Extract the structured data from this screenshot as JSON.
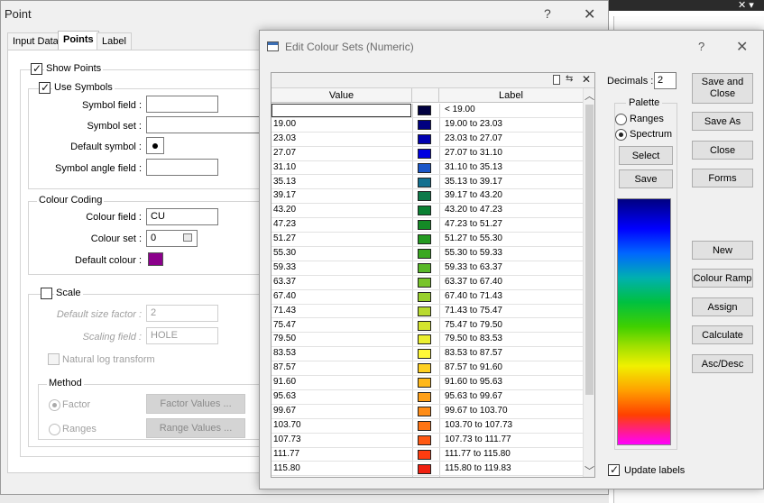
{
  "background_window": {
    "close_glyph": "✕",
    "chevron_glyph": "▾"
  },
  "point_window": {
    "title": "Point",
    "help_glyph": "?",
    "close_glyph": "✕",
    "tabs": [
      "Input Data",
      "Points",
      "Label"
    ],
    "show_points_label": "Show Points",
    "use_symbols_label": "Use Symbols",
    "symbol_field_label": "Symbol field :",
    "symbol_set_label": "Symbol set :",
    "default_symbol_label": "Default symbol :",
    "symbol_angle_field_label": "Symbol angle field :",
    "colour_coding_title": "Colour Coding",
    "colour_field_label": "Colour field :",
    "colour_field_value": "CU",
    "colour_set_label": "Colour set :",
    "colour_set_value": "0",
    "default_colour_label": "Default colour :",
    "default_colour": "#8b008b",
    "scale_label": "Scale",
    "default_size_factor_label": "Default size factor :",
    "default_size_factor_value": "2",
    "scaling_field_label": "Scaling field :",
    "scaling_field_value": "HOLE",
    "natural_log_label": "Natural log transform",
    "method_title": "Method",
    "factor_label": "Factor",
    "ranges_label": "Ranges",
    "factor_values_btn": "Factor Values ...",
    "range_values_btn": "Range Values ..."
  },
  "edit_colour_sets": {
    "title": "Edit Colour Sets (Numeric)",
    "help_glyph": "?",
    "close_glyph": "✕",
    "columns": {
      "value": "Value",
      "label": "Label"
    },
    "rows": [
      {
        "value": "",
        "label": "< 19.00",
        "color": "#000040"
      },
      {
        "value": "19.00",
        "label": "19.00 to 23.03",
        "color": "#000080"
      },
      {
        "value": "23.03",
        "label": "23.03 to 27.07",
        "color": "#0000b0"
      },
      {
        "value": "27.07",
        "label": "27.07 to 31.10",
        "color": "#0000e0"
      },
      {
        "value": "31.10",
        "label": "31.10 to 35.13",
        "color": "#1a56c8"
      },
      {
        "value": "35.13",
        "label": "35.13 to 39.17",
        "color": "#127090"
      },
      {
        "value": "39.17",
        "label": "39.17 to 43.20",
        "color": "#0e7a4a"
      },
      {
        "value": "43.20",
        "label": "43.20 to 47.23",
        "color": "#0a8032"
      },
      {
        "value": "47.23",
        "label": "47.23 to 51.27",
        "color": "#148a26"
      },
      {
        "value": "51.27",
        "label": "51.27 to 55.30",
        "color": "#239a20"
      },
      {
        "value": "55.30",
        "label": "55.30 to 59.33",
        "color": "#3aa820"
      },
      {
        "value": "59.33",
        "label": "59.33 to 63.37",
        "color": "#58b828"
      },
      {
        "value": "63.37",
        "label": "63.37 to 67.40",
        "color": "#78c42a"
      },
      {
        "value": "67.40",
        "label": "67.40 to 71.43",
        "color": "#98d02c"
      },
      {
        "value": "71.43",
        "label": "71.43 to 75.47",
        "color": "#b8da2e"
      },
      {
        "value": "75.47",
        "label": "75.47 to 79.50",
        "color": "#d4e42e"
      },
      {
        "value": "79.50",
        "label": "79.50 to 83.53",
        "color": "#ecf030"
      },
      {
        "value": "83.53",
        "label": "83.53 to 87.57",
        "color": "#fff838"
      },
      {
        "value": "87.57",
        "label": "87.57 to 91.60",
        "color": "#ffd020"
      },
      {
        "value": "91.60",
        "label": "91.60 to 95.63",
        "color": "#ffb81a"
      },
      {
        "value": "95.63",
        "label": "95.63 to 99.67",
        "color": "#ffa018"
      },
      {
        "value": "99.67",
        "label": "99.67 to 103.70",
        "color": "#ff8c16"
      },
      {
        "value": "103.70",
        "label": "103.70 to 107.73",
        "color": "#ff7414"
      },
      {
        "value": "107.73",
        "label": "107.73 to 111.77",
        "color": "#ff5812"
      },
      {
        "value": "111.77",
        "label": "111.77 to 115.80",
        "color": "#ff3c10"
      },
      {
        "value": "115.80",
        "label": "115.80 to 119.83",
        "color": "#f02010"
      }
    ],
    "decimals_label": "Decimals :",
    "decimals_value": "2",
    "palette_title": "Palette",
    "palette_ranges": "Ranges",
    "palette_spectrum": "Spectrum",
    "select_btn": "Select",
    "save_btn": "Save",
    "update_labels": "Update labels",
    "buttons": {
      "save_and_close_1": "Save and",
      "save_and_close_2": "Close",
      "save_as": "Save As",
      "close": "Close",
      "forms": "Forms",
      "new": "New",
      "colour_ramp": "Colour Ramp",
      "assign": "Assign",
      "calculate": "Calculate",
      "asc_desc": "Asc/Desc"
    }
  }
}
